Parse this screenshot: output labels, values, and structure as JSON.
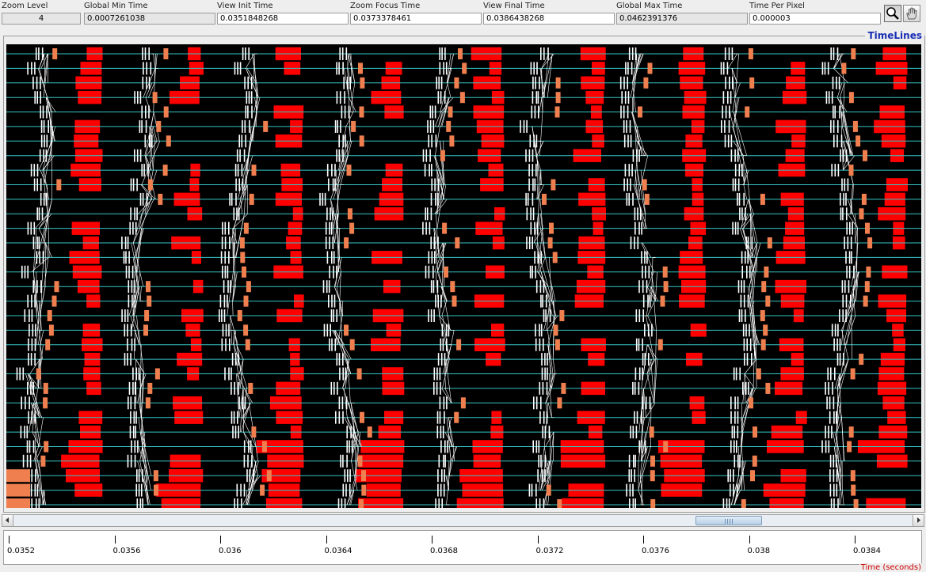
{
  "fields": [
    {
      "label": "Zoom Level",
      "value": "4",
      "style": "ro center"
    },
    {
      "label": "Global Min Time",
      "value": "0.0007261038",
      "style": "ro"
    },
    {
      "label": "View  Init Time",
      "value": "0.0351848268",
      "style": "ed"
    },
    {
      "label": "Zoom Focus Time",
      "value": "0.0373378461",
      "style": "ed"
    },
    {
      "label": "View Final Time",
      "value": "0.0386438268",
      "style": "ed"
    },
    {
      "label": "Global Max Time",
      "value": "0.0462391376",
      "style": "ro"
    },
    {
      "label": "Time Per Pixel",
      "value": "0.000003",
      "style": "ed"
    }
  ],
  "tools": {
    "zoom": "magnifier-icon",
    "pan": "hand-icon"
  },
  "panel": {
    "title": "TimeLines"
  },
  "colors": {
    "background": "#000000",
    "timeline": "#36c6c6",
    "state_red": "#ff0000",
    "state_orange": "#f07f50",
    "event_white": "#ffffff",
    "title_blue": "#1a2fb5",
    "axis_title_red": "#d00000"
  },
  "timeline_count": 32,
  "ruler": {
    "ticks": [
      "0.0352",
      "0.0356",
      "0.036",
      "0.0364",
      "0.0368",
      "0.0372",
      "0.0376",
      "0.038",
      "0.0384"
    ],
    "axis_title": "Time (seconds)"
  }
}
